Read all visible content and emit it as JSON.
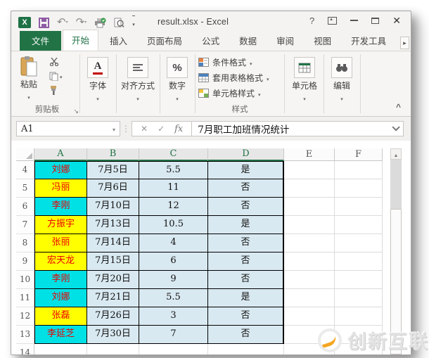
{
  "window": {
    "title": "result.xlsx - Excel",
    "controls": {
      "help": "?"
    }
  },
  "qat": {
    "icons": [
      "excel-logo",
      "save",
      "undo",
      "redo",
      "print-with-status",
      "print-preview",
      "customize-quick-access-toolbar"
    ]
  },
  "tabs": {
    "file": "文件",
    "active": "开始",
    "items": [
      "开始",
      "插入",
      "页面布局",
      "公式",
      "数据",
      "审阅",
      "视图",
      "开发工具"
    ]
  },
  "ribbon": {
    "clipboard": {
      "paste": "粘贴",
      "group_label": "剪贴板"
    },
    "font": {
      "label": "字体"
    },
    "alignment": {
      "label": "对齐方式"
    },
    "number": {
      "label": "数字"
    },
    "styles": {
      "items": [
        "条件格式",
        "套用表格格式",
        "单元格样式"
      ],
      "group_label": "样式"
    },
    "cells": {
      "label": "单元格"
    },
    "editing": {
      "label": "编辑"
    }
  },
  "formula_bar": {
    "name_box": "A1",
    "cancel": "✕",
    "enter": "✓",
    "fx": "fx",
    "value": "7月职工加班情况统计"
  },
  "sheet": {
    "columns": [
      "A",
      "B",
      "C",
      "D",
      "E",
      "F"
    ],
    "selected_columns": [
      "A",
      "B",
      "C",
      "D"
    ],
    "colors": {
      "cyan": "#00E1E6",
      "yellow": "#FFFF00",
      "data_fill": "#D9E9F1",
      "name_text": "#EE0000",
      "selection_green": "#217346"
    },
    "rows": [
      {
        "n": "4",
        "name": "刘娜",
        "fill": "cyan",
        "date": "7月5日",
        "hours": "5.5",
        "overtime": "是"
      },
      {
        "n": "5",
        "name": "冯丽",
        "fill": "yellow",
        "date": "7月6日",
        "hours": "11",
        "overtime": "否"
      },
      {
        "n": "6",
        "name": "李刚",
        "fill": "cyan",
        "date": "7月10日",
        "hours": "12",
        "overtime": "否"
      },
      {
        "n": "7",
        "name": "方振宇",
        "fill": "yellow",
        "date": "7月13日",
        "hours": "10.5",
        "overtime": "是"
      },
      {
        "n": "8",
        "name": "张丽",
        "fill": "yellow",
        "date": "7月14日",
        "hours": "4",
        "overtime": "否"
      },
      {
        "n": "9",
        "name": "宏天龙",
        "fill": "yellow",
        "date": "7月15日",
        "hours": "6",
        "overtime": "否"
      },
      {
        "n": "10",
        "name": "李刚",
        "fill": "cyan",
        "date": "7月20日",
        "hours": "9",
        "overtime": "否"
      },
      {
        "n": "11",
        "name": "刘娜",
        "fill": "cyan",
        "date": "7月21日",
        "hours": "5.5",
        "overtime": "是"
      },
      {
        "n": "12",
        "name": "张磊",
        "fill": "yellow",
        "date": "7月26日",
        "hours": "3",
        "overtime": "否"
      },
      {
        "n": "13",
        "name": "李延芝",
        "fill": "cyan",
        "date": "7月30日",
        "hours": "7",
        "overtime": "否"
      },
      {
        "n": "14",
        "empty": true
      }
    ]
  },
  "watermark": {
    "text": "创新互联"
  }
}
